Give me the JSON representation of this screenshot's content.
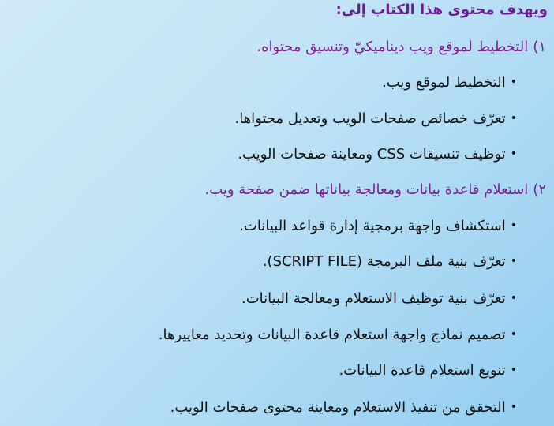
{
  "intro": "ويهدف محتوى هذا الكتاب إلى:",
  "sections": [
    {
      "number": "١)",
      "title": "التخطيط لموقع ويب ديناميكيّ وتنسيق محتواه.",
      "bullets": [
        "التخطيط لموقع ويب.",
        "تعرّف خصائص صفحات الويب وتعديل محتواها.",
        "توظيف تنسيقات CSS ومعاينة صفحات الويب."
      ]
    },
    {
      "number": "٢)",
      "title": "استعلام قاعدة بيانات ومعالجة بياناتها ضمن صفحة ويب.",
      "bullets": [
        "استكشاف واجهة برمجية إدارة قواعد البيانات.",
        "تعرّف بنية ملف البرمجة (SCRIPT FILE).",
        "تعرّف بنية توظيف الاستعلام ومعالجة البيانات.",
        "تصميم نماذج واجهة استعلام قاعدة البيانات وتحديد معاييرها.",
        "تنويع استعلام قاعدة البيانات.",
        "التحقق من تنفيذ الاستعلام ومعاينة محتوى صفحات الويب."
      ]
    }
  ],
  "bullet_glyph": "•",
  "colors": {
    "heading": "#6b1c94",
    "section": "#7a1f8f",
    "text": "#111111",
    "background_light": "#cfeaf8",
    "background_dark": "#93cdf0"
  }
}
